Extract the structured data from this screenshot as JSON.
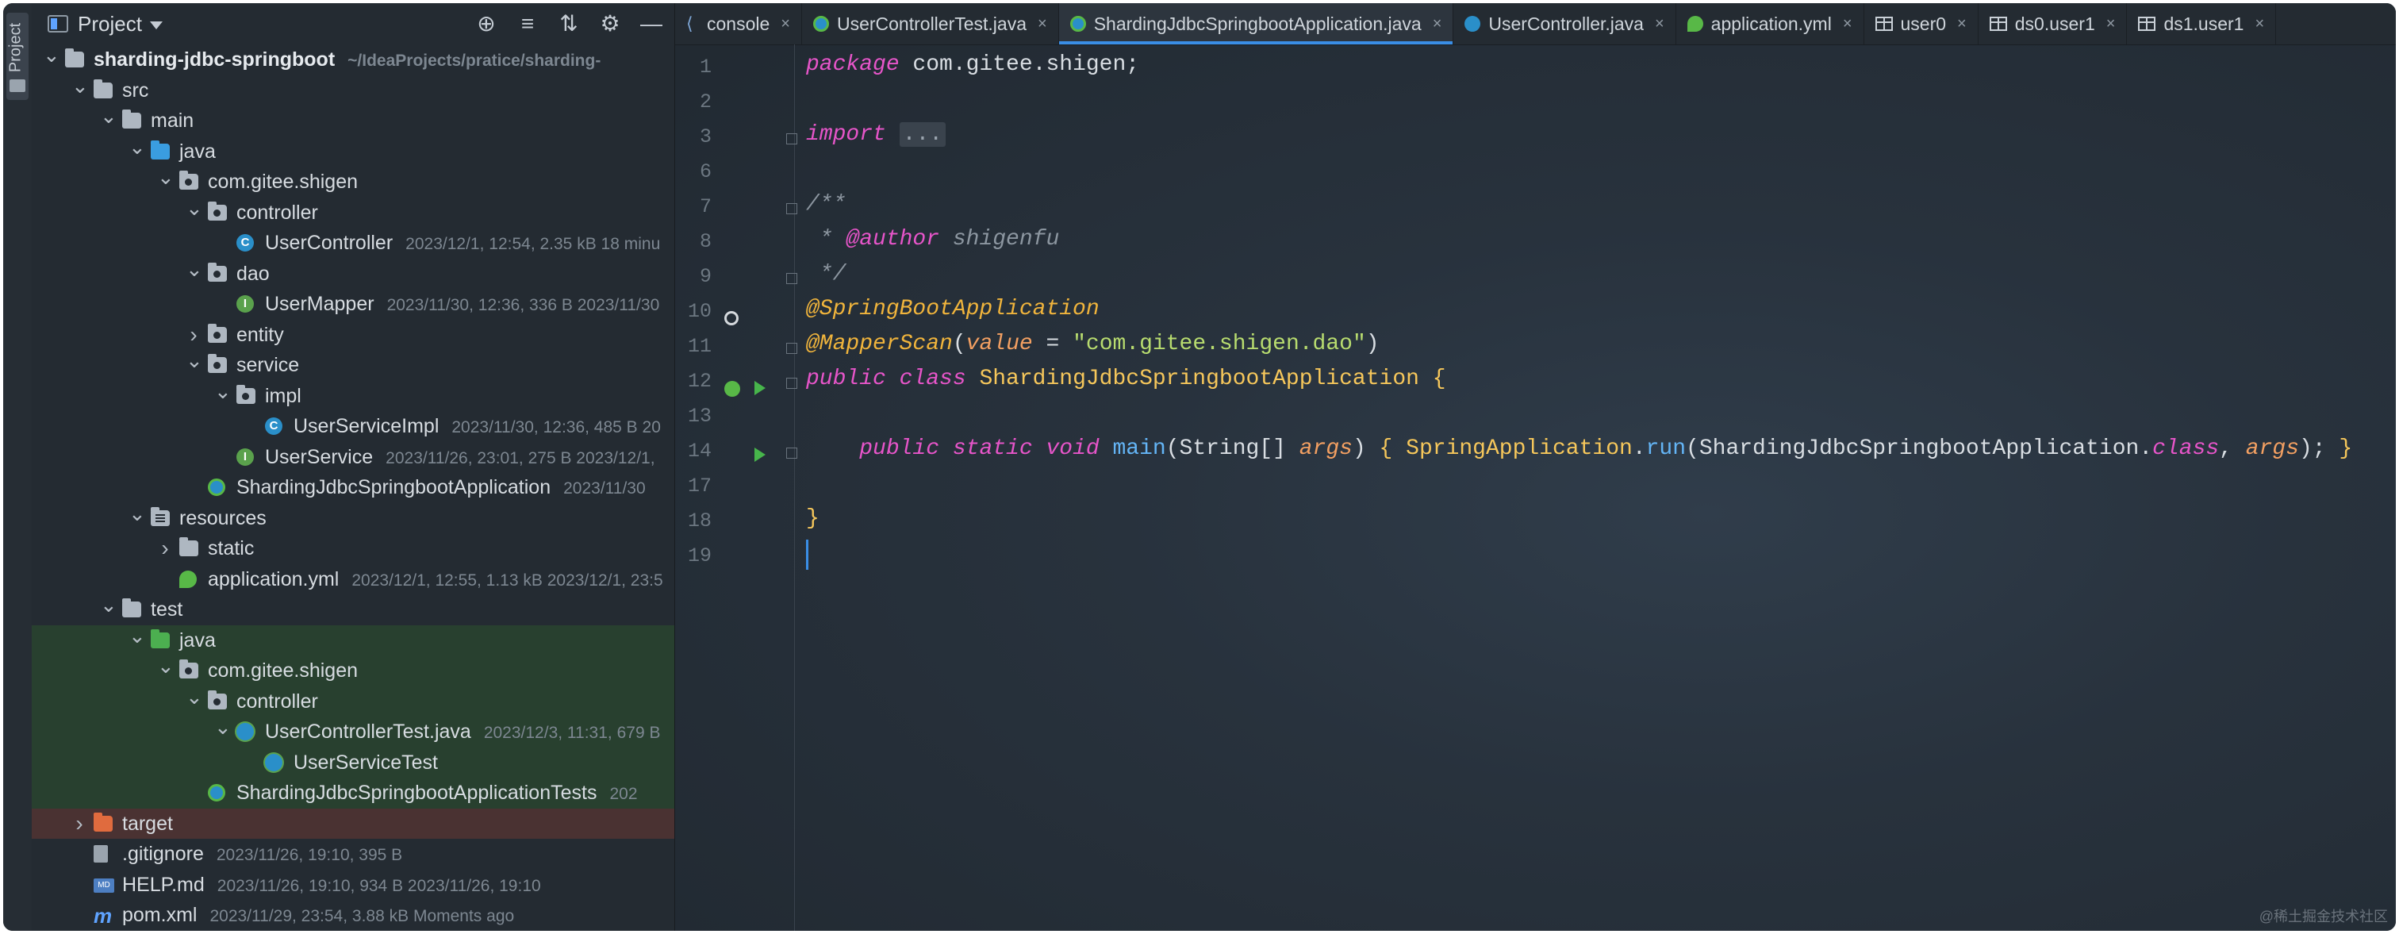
{
  "project_panel": {
    "tool_tab_label": "Project",
    "title": "Project",
    "tools": [
      "⊕",
      "≡",
      "⇅",
      "⚙",
      "—"
    ],
    "tree": [
      {
        "depth": 0,
        "expanded": "open",
        "icon": "folder-grey",
        "name": "sharding-jdbc-springboot",
        "meta": "~/IdeaProjects/pratice/sharding-",
        "bold": true
      },
      {
        "depth": 1,
        "expanded": "open",
        "icon": "folder-grey",
        "name": "src",
        "meta": ""
      },
      {
        "depth": 2,
        "expanded": "open",
        "icon": "folder-grey",
        "name": "main",
        "meta": ""
      },
      {
        "depth": 3,
        "expanded": "open",
        "icon": "folder-blue",
        "name": "java",
        "meta": ""
      },
      {
        "depth": 4,
        "expanded": "open",
        "icon": "folder-pkg",
        "name": "com.gitee.shigen",
        "meta": ""
      },
      {
        "depth": 5,
        "expanded": "open",
        "icon": "folder-pkg",
        "name": "controller",
        "meta": ""
      },
      {
        "depth": 6,
        "expanded": "",
        "icon": "class",
        "name": "UserController",
        "meta": "2023/12/1, 12:54, 2.35 kB 18 minu"
      },
      {
        "depth": 5,
        "expanded": "open",
        "icon": "folder-pkg",
        "name": "dao",
        "meta": ""
      },
      {
        "depth": 6,
        "expanded": "",
        "icon": "interface",
        "name": "UserMapper",
        "meta": "2023/11/30, 12:36, 336 B 2023/11/30"
      },
      {
        "depth": 5,
        "expanded": "closed",
        "icon": "folder-pkg",
        "name": "entity",
        "meta": ""
      },
      {
        "depth": 5,
        "expanded": "open",
        "icon": "folder-pkg",
        "name": "service",
        "meta": ""
      },
      {
        "depth": 6,
        "expanded": "open",
        "icon": "folder-pkg",
        "name": "impl",
        "meta": ""
      },
      {
        "depth": 7,
        "expanded": "",
        "icon": "class",
        "name": "UserServiceImpl",
        "meta": "2023/11/30, 12:36, 485 B 20"
      },
      {
        "depth": 6,
        "expanded": "",
        "icon": "interface",
        "name": "UserService",
        "meta": "2023/11/26, 23:01, 275 B 2023/12/1,"
      },
      {
        "depth": 5,
        "expanded": "",
        "icon": "spring",
        "name": "ShardingJdbcSpringbootApplication",
        "meta": "2023/11/30"
      },
      {
        "depth": 3,
        "expanded": "open",
        "icon": "folder-res",
        "name": "resources",
        "meta": ""
      },
      {
        "depth": 4,
        "expanded": "closed",
        "icon": "folder-grey",
        "name": "static",
        "meta": ""
      },
      {
        "depth": 4,
        "expanded": "",
        "icon": "yml",
        "name": "application.yml",
        "meta": "2023/12/1, 12:55, 1.13 kB 2023/12/1, 23:5"
      },
      {
        "depth": 2,
        "expanded": "open",
        "icon": "folder-grey",
        "name": "test",
        "meta": ""
      },
      {
        "depth": 3,
        "expanded": "open",
        "icon": "folder-green",
        "name": "java",
        "meta": "",
        "bg": "test"
      },
      {
        "depth": 4,
        "expanded": "open",
        "icon": "folder-pkg",
        "name": "com.gitee.shigen",
        "meta": "",
        "bg": "test"
      },
      {
        "depth": 5,
        "expanded": "open",
        "icon": "folder-pkg",
        "name": "controller",
        "meta": "",
        "bg": "test"
      },
      {
        "depth": 6,
        "expanded": "open",
        "icon": "test-class",
        "name": "UserControllerTest.java",
        "meta": "2023/12/3, 11:31, 679 B",
        "bg": "test"
      },
      {
        "depth": 7,
        "expanded": "",
        "icon": "test-class",
        "name": "UserServiceTest",
        "meta": "",
        "bg": "test"
      },
      {
        "depth": 5,
        "expanded": "",
        "icon": "spring",
        "name": "ShardingJdbcSpringbootApplicationTests",
        "meta": "202",
        "bg": "test"
      },
      {
        "depth": 1,
        "expanded": "closed",
        "icon": "folder-orange",
        "name": "target",
        "meta": "",
        "bg": "target"
      },
      {
        "depth": 1,
        "expanded": "",
        "icon": "file",
        "name": ".gitignore",
        "meta": "2023/11/26, 19:10, 395 B"
      },
      {
        "depth": 1,
        "expanded": "",
        "icon": "md",
        "name": "HELP.md",
        "meta": "2023/11/26, 19:10, 934 B 2023/11/26, 19:10"
      },
      {
        "depth": 1,
        "expanded": "",
        "icon": "maven",
        "name": "pom.xml",
        "meta": "2023/11/29, 23:54, 3.88 kB Moments ago"
      }
    ]
  },
  "tabs": [
    {
      "label": "console",
      "icon": "console",
      "active": false
    },
    {
      "label": "UserControllerTest.java",
      "icon": "spring",
      "active": false
    },
    {
      "label": "ShardingJdbcSpringbootApplication.java",
      "icon": "spring",
      "active": true
    },
    {
      "label": "UserController.java",
      "icon": "class",
      "active": false
    },
    {
      "label": "application.yml",
      "icon": "yml",
      "active": false
    },
    {
      "label": "user0",
      "icon": "table",
      "active": false
    },
    {
      "label": "ds0.user1",
      "icon": "table",
      "active": false
    },
    {
      "label": "ds1.user1",
      "icon": "table",
      "active": false
    }
  ],
  "editor": {
    "line_numbers": [
      "1",
      "2",
      "3",
      "6",
      "7",
      "8",
      "9",
      "10",
      "11",
      "12",
      "13",
      "14",
      "17",
      "18",
      "19"
    ],
    "code": {
      "l1_kw": "package",
      "l1_rest": " com.gitee.shigen;",
      "l3_kw": "import",
      "l3_folded": "...",
      "l7": "/**",
      "l8_star": " * ",
      "l8_tag": "@author",
      "l8_name": " shigenfu",
      "l9": " */",
      "l10": "@SpringBootApplication",
      "l11_ann": "@MapperScan",
      "l11_p1": "(",
      "l11_key": "value",
      "l11_eq": " = ",
      "l11_str": "\"com.gitee.shigen.dao\"",
      "l11_p2": ")",
      "l12_kw": "public class",
      "l12_cls": " ShardingJdbcSpringbootApplication",
      "l12_brace": " {",
      "l14_kw": "public static void",
      "l14_fn": " main",
      "l14_p1": "(String[] ",
      "l14_param": "args",
      "l14_p2": ") ",
      "l14_b1": "{",
      "l14_cls1": " SpringApplication",
      "l14_dot": ".",
      "l14_run": "run",
      "l14_p3": "(ShardingJdbcSpringbootApplication.",
      "l14_class": "class",
      "l14_comma": ", ",
      "l14_args": "args",
      "l14_end": "); ",
      "l14_b2": "}",
      "l18": "}"
    }
  },
  "watermark": "@稀土掘金技术社区"
}
